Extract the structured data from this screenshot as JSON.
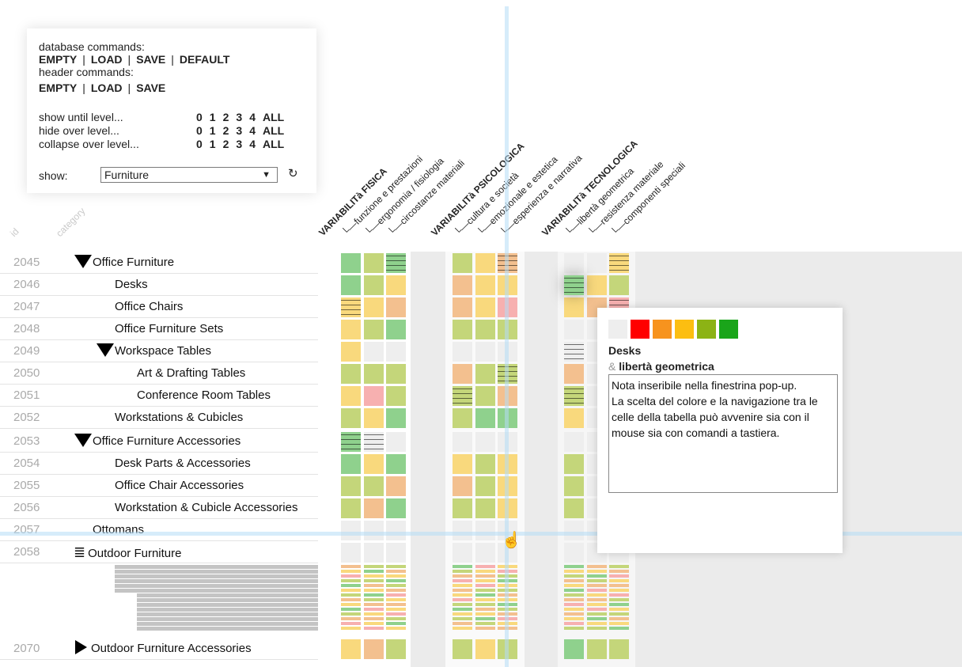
{
  "panel": {
    "db_caption": "database commands:",
    "db_cmds": [
      "EMPTY",
      "LOAD",
      "SAVE",
      "DEFAULT"
    ],
    "hdr_caption": "header commands:",
    "hdr_cmds": [
      "EMPTY",
      "LOAD",
      "SAVE"
    ],
    "sep": "|",
    "level_rows": [
      {
        "label": "show until level...",
        "opts": [
          "0",
          "1",
          "2",
          "3",
          "4",
          "ALL"
        ]
      },
      {
        "label": "hide over level...",
        "opts": [
          "0",
          "1",
          "2",
          "3",
          "4",
          "ALL"
        ]
      },
      {
        "label": "collapse over level...",
        "opts": [
          "0",
          "1",
          "2",
          "3",
          "4",
          "ALL"
        ]
      }
    ],
    "show_label": "show:",
    "show_value": "Furniture",
    "refresh_glyph": "↻"
  },
  "columns": {
    "id_header": "id",
    "category_header": "category",
    "groups": [
      {
        "title": "VARIABILITà FISICA",
        "subs": [
          "funzione e prestazioni",
          "ergonomia / fisiologia",
          "circostanze materiali"
        ]
      },
      {
        "title": "VARIABILITà PSICOLOGICA",
        "subs": [
          "cultura e società",
          "emozionale e estetica",
          "esperienza e narrativa"
        ]
      },
      {
        "title": "VARIABILITà TECNOLOGICA",
        "subs": [
          "libertà geometrica",
          "resistenza materiale",
          "componenti speciali"
        ]
      }
    ]
  },
  "rows": [
    {
      "id": "2045",
      "label": "Office Furniture",
      "level": 0,
      "toggle": "expanded"
    },
    {
      "id": "2046",
      "label": "Desks",
      "level": 1,
      "toggle": "none"
    },
    {
      "id": "2047",
      "label": "Office Chairs",
      "level": 1,
      "toggle": "none"
    },
    {
      "id": "2048",
      "label": "Office Furniture Sets",
      "level": 1,
      "toggle": "none"
    },
    {
      "id": "2049",
      "label": "Workspace Tables",
      "level": 1,
      "toggle": "expanded"
    },
    {
      "id": "2050",
      "label": "Art & Drafting Tables",
      "level": 2,
      "toggle": "none"
    },
    {
      "id": "2051",
      "label": "Conference Room Tables",
      "level": 2,
      "toggle": "none"
    },
    {
      "id": "2052",
      "label": "Workstations & Cubicles",
      "level": 1,
      "toggle": "none"
    },
    {
      "id": "2053",
      "label": "Office Furniture Accessories",
      "level": 0,
      "toggle": "expanded"
    },
    {
      "id": "2054",
      "label": "Desk Parts & Accessories",
      "level": 1,
      "toggle": "none"
    },
    {
      "id": "2055",
      "label": "Office Chair Accessories",
      "level": 1,
      "toggle": "none"
    },
    {
      "id": "2056",
      "label": "Workstation & Cubicle Accessories",
      "level": 1,
      "toggle": "none"
    },
    {
      "id": "2057",
      "label": "Ottomans",
      "level": 0,
      "toggle": "none"
    },
    {
      "id": "2058",
      "label": "Outdoor Furniture",
      "level": 0,
      "toggle": "filtered"
    },
    {
      "id": "2070",
      "label": "Outdoor Furniture Accessories",
      "level": 0,
      "toggle": "collapsed"
    }
  ],
  "colors": {
    "empty": "#eeeeee",
    "green": "#8fd18d",
    "lime": "#c4d67a",
    "yellow": "#f9d97d",
    "orange": "#f3c08f",
    "pink": "#f7b0b0",
    "highlight_band": "#ffffff"
  },
  "grid": [
    [
      "green",
      "lime",
      "green~",
      "lime",
      "yellow",
      "orange~",
      "",
      "",
      "yellow~"
    ],
    [
      "green",
      "lime",
      "yellow",
      "orange",
      "yellow",
      "yellow",
      "green~",
      "yellow",
      "lime"
    ],
    [
      "yellow~",
      "yellow",
      "orange",
      "orange",
      "yellow",
      "pink",
      "yellow",
      "orange",
      "pink~"
    ],
    [
      "yellow",
      "lime",
      "green",
      "lime",
      "lime",
      "lime",
      "",
      "",
      ""
    ],
    [
      "yellow",
      "",
      "",
      "",
      "",
      "",
      "empty~",
      "",
      ""
    ],
    [
      "lime",
      "lime",
      "lime",
      "orange",
      "lime",
      "lime~",
      "orange",
      "",
      ""
    ],
    [
      "yellow",
      "pink",
      "lime",
      "lime~",
      "lime",
      "orange",
      "lime~",
      "",
      ""
    ],
    [
      "lime",
      "yellow",
      "green",
      "lime",
      "green",
      "green",
      "yellow",
      "",
      ""
    ],
    [
      "green~",
      "empty~",
      "",
      "",
      "",
      "",
      "",
      "",
      ""
    ],
    [
      "green",
      "yellow",
      "green",
      "yellow",
      "lime",
      "yellow",
      "lime",
      "",
      ""
    ],
    [
      "lime",
      "lime",
      "orange",
      "orange",
      "lime",
      "yellow",
      "lime",
      "",
      ""
    ],
    [
      "lime",
      "orange",
      "green",
      "lime",
      "lime",
      "yellow",
      "lime",
      "",
      ""
    ],
    [
      "",
      "",
      "",
      "",
      "",
      "",
      "",
      "",
      ""
    ],
    [
      "",
      "",
      "",
      "",
      "",
      "",
      "",
      "",
      ""
    ],
    [
      "yellow",
      "orange",
      "lime",
      "lime",
      "yellow",
      "lime",
      "green",
      "lime",
      "lime"
    ]
  ],
  "popup": {
    "swatches": [
      "#eeeeee",
      "#ff0000",
      "#f7931e",
      "#fcbe11",
      "#8cb315",
      "#1aa51a"
    ],
    "title": "Desks",
    "amp": "&",
    "subtitle": "libertà geometrica",
    "note": "Nota inseribile nella finestrina pop-up.\nLa scelta del colore e la navigazione tra le celle della tabella può avvenire sia con il mouse sia con comandi a tastiera."
  },
  "cursor_glyph": "☝"
}
